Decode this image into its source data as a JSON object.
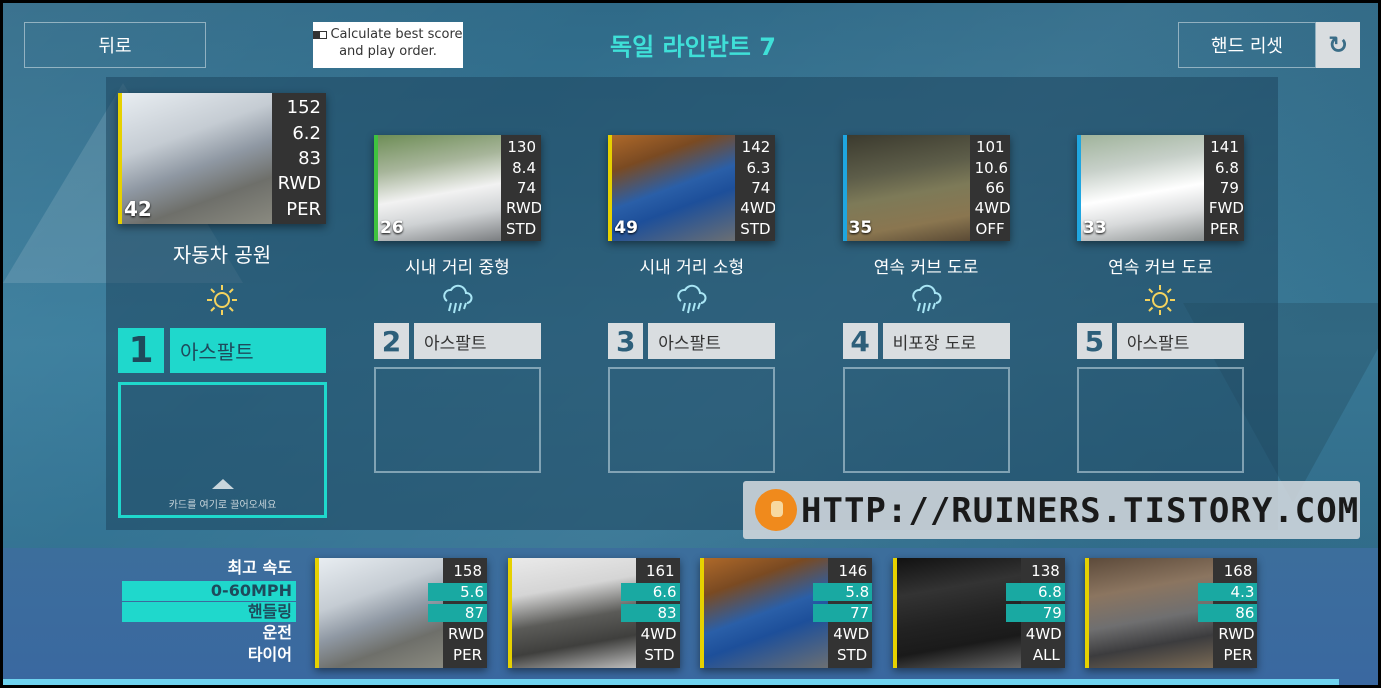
{
  "header": {
    "back_label": "뒤로",
    "calc_label": "Calculate best score and play order.",
    "title": "독일 라인란트 7",
    "reset_label": "핸드 리셋",
    "reset_icon": "refresh-icon"
  },
  "slots": [
    {
      "num": "1",
      "location": "자동차 공원",
      "weather": "sunny-icon",
      "surface": "아스팔트",
      "active": true,
      "card": {
        "stats": [
          "152",
          "6.2",
          "83",
          "RWD",
          "PER"
        ],
        "pi": "42",
        "color": "#e6d100",
        "photo": "porsche-boxster"
      }
    },
    {
      "num": "2",
      "location": "시내 거리 중형",
      "weather": "rain-icon",
      "surface": "아스팔트",
      "card": {
        "stats": [
          "130",
          "8.4",
          "74",
          "RWD",
          "STD"
        ],
        "pi": "26",
        "color": "#3fc23f",
        "photo": "bmw-1-series"
      }
    },
    {
      "num": "3",
      "location": "시내 거리 소형",
      "weather": "rain-icon",
      "surface": "아스팔트",
      "card": {
        "stats": [
          "142",
          "6.3",
          "74",
          "4WD",
          "STD"
        ],
        "pi": "49",
        "color": "#e6d100",
        "photo": "bmw-2-series"
      }
    },
    {
      "num": "4",
      "location": "연속 커브 도로",
      "weather": "rain-icon",
      "surface": "비포장 도로",
      "card": {
        "stats": [
          "101",
          "10.6",
          "66",
          "4WD",
          "OFF"
        ],
        "pi": "35",
        "color": "#1fa6e0",
        "photo": "mercedes-g-wagon"
      }
    },
    {
      "num": "5",
      "location": "연속 커브 도로",
      "weather": "sunny-icon",
      "surface": "아스팔트",
      "card": {
        "stats": [
          "141",
          "6.8",
          "79",
          "FWD",
          "PER"
        ],
        "pi": "33",
        "color": "#1fa6e0",
        "photo": "vw-polo"
      }
    }
  ],
  "drop_hint": "카드를 여기로 끌어오세요",
  "sort_labels": [
    "최고 속도",
    "0-60MPH",
    "핸들링",
    "운전",
    "타이어"
  ],
  "hand": [
    {
      "stats": [
        "158",
        "5.6",
        "87",
        "RWD",
        "PER"
      ],
      "color": "#e6d100",
      "photo": "porsche-boxster"
    },
    {
      "stats": [
        "161",
        "6.6",
        "83",
        "4WD",
        "STD"
      ],
      "color": "#e6d100",
      "photo": "vw-phaeton"
    },
    {
      "stats": [
        "146",
        "5.8",
        "77",
        "4WD",
        "STD"
      ],
      "color": "#e6d100",
      "photo": "bmw-2-series"
    },
    {
      "stats": [
        "138",
        "6.8",
        "79",
        "4WD",
        "ALL"
      ],
      "color": "#e6d100",
      "photo": "vw-touareg"
    },
    {
      "stats": [
        "168",
        "4.3",
        "86",
        "RWD",
        "PER"
      ],
      "color": "#e6d100",
      "photo": "bmw-z4"
    }
  ],
  "watermark": "HTTP://RUINERS.TISTORY.COM"
}
